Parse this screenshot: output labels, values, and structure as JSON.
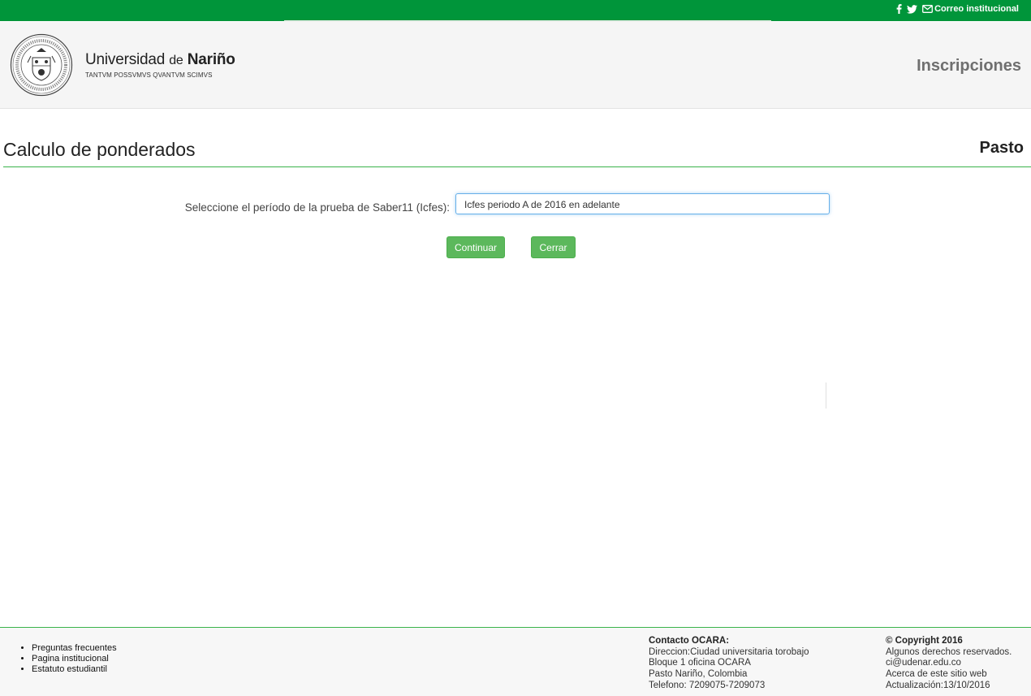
{
  "topbar": {
    "facebook_icon": "facebook-icon",
    "twitter_icon": "twitter-icon",
    "mail_icon": "envelope-icon",
    "mail_label": "Correo institucional",
    "color": "#00953a"
  },
  "header": {
    "brand_part1": "Universidad",
    "brand_part2": "de",
    "brand_part3": "Nariño",
    "motto": "TANTVM POSSVMVS QVANTVM SCIMVS",
    "section_title": "Inscripciones"
  },
  "page": {
    "title": "Calculo de ponderados",
    "campus": "Pasto"
  },
  "form": {
    "label": "Seleccione el período de la prueba de Saber11 (Icfes):",
    "selected_period": "Icfes periodo A de 2016 en adelante",
    "continue_label": "Continuar",
    "close_label": "Cerrar",
    "button_color": "#5cb85c"
  },
  "footer": {
    "links": [
      "Preguntas frecuentes",
      "Pagina institucional",
      "Estatuto estudiantil"
    ],
    "contact": {
      "heading": "Contacto OCARA:",
      "lines": [
        "Direccion:Ciudad universitaria torobajo",
        "Bloque 1 oficina OCARA",
        "Pasto Nariño, Colombia",
        "Telefono: 7209075-7209073"
      ]
    },
    "rights": {
      "heading": "© Copyright 2016",
      "reserved": "Algunos derechos reservados.",
      "email": "ci@udenar.edu.co",
      "about": "Acerca de este sitio web",
      "updated": "Actualización:13/10/2016"
    }
  }
}
